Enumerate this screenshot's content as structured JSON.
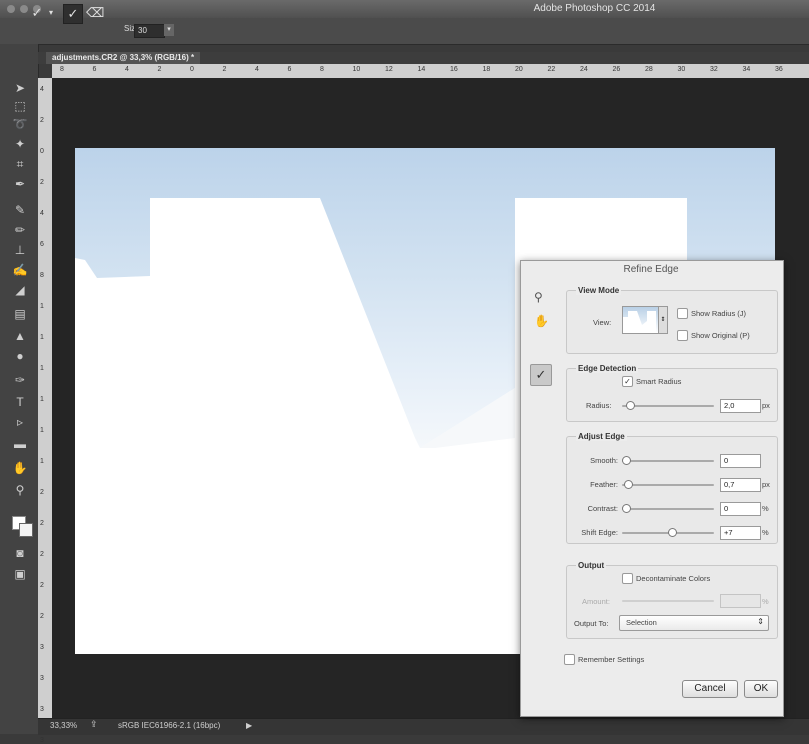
{
  "window": {
    "title": "Adobe Photoshop CC 2014"
  },
  "options_bar": {
    "size_label": "Size:",
    "size_value": "30",
    "dropdown_arrow": "▾"
  },
  "document": {
    "tab_label": "adjustments.CR2 @ 33,3% (RGB/16) *"
  },
  "rulers": {
    "horizontal": [
      "8",
      "6",
      "4",
      "2",
      "0",
      "2",
      "4",
      "6",
      "8",
      "10",
      "12",
      "14",
      "16",
      "18",
      "20",
      "22",
      "24",
      "26",
      "28",
      "30",
      "32",
      "34",
      "36"
    ],
    "vertical": [
      "4",
      "2",
      "0",
      "2",
      "4",
      "6",
      "8",
      "1",
      "1",
      "1",
      "1",
      "1",
      "1",
      "2",
      "2",
      "2",
      "2",
      "2",
      "3",
      "3",
      "3",
      "3"
    ]
  },
  "status_bar": {
    "zoom": "33,33%",
    "profile": "sRGB IEC61966-2.1 (16bpc)",
    "arrow": "▶"
  },
  "dialog": {
    "title": "Refine Edge",
    "view_mode": {
      "title": "View Mode",
      "view_label": "View:",
      "show_radius": "Show Radius (J)",
      "show_original": "Show Original (P)"
    },
    "edge_detection": {
      "title": "Edge Detection",
      "smart_radius": "Smart Radius",
      "smart_radius_checked": true,
      "radius_label": "Radius:",
      "radius_value": "2,0",
      "radius_unit": "px",
      "radius_slider": 0.05
    },
    "adjust_edge": {
      "title": "Adjust Edge",
      "rows": [
        {
          "label": "Smooth:",
          "value": "0",
          "unit": "",
          "slider": 0.0
        },
        {
          "label": "Feather:",
          "value": "0,7",
          "unit": "px",
          "slider": 0.02
        },
        {
          "label": "Contrast:",
          "value": "0",
          "unit": "%",
          "slider": 0.0
        },
        {
          "label": "Shift Edge:",
          "value": "+7",
          "unit": "%",
          "slider": 0.55
        }
      ]
    },
    "output": {
      "title": "Output",
      "decontaminate": "Decontaminate Colors",
      "amount_label": "Amount:",
      "amount_unit": "%",
      "output_to_label": "Output To:",
      "output_to_value": "Selection",
      "output_to_arrow": "⇕"
    },
    "remember": "Remember Settings",
    "cancel": "Cancel",
    "ok": "OK"
  },
  "colors": {
    "canvas_sky": "#bcd3ea",
    "panel_bg": "#ececec",
    "app_bg": "#3a3a3a"
  }
}
